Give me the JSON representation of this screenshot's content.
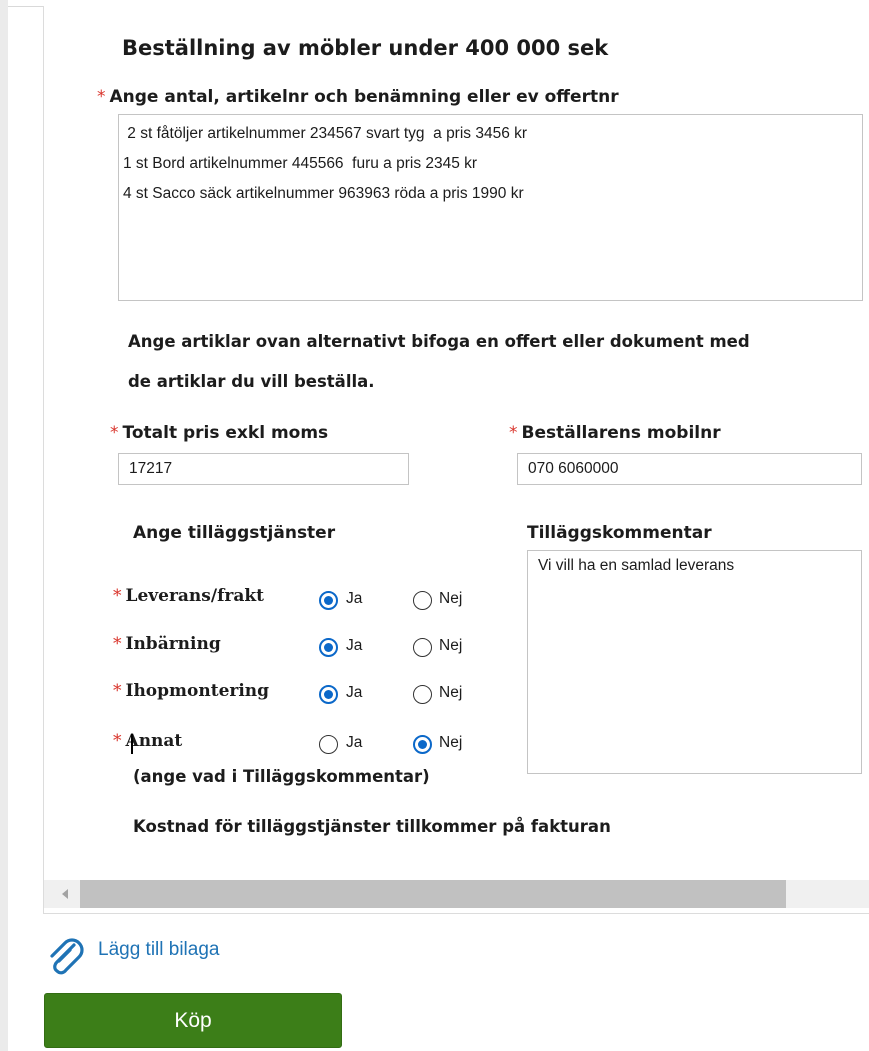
{
  "form": {
    "title": "Beställning av möbler under 400 000 sek",
    "required_marker": "*",
    "articles": {
      "label": "Ange antal, artikelnr och benämning eller ev offertnr",
      "lines": [
        " 2 st fåtöljer artikelnummer 234567 svart tyg  a pris 3456 kr",
        "1 st Bord artikelnummer 445566  furu a pris 2345 kr",
        "4 st Sacco säck artikelnummer 963963 röda a pris 1990 kr"
      ]
    },
    "info_line1": "Ange artiklar ovan alternativt bifoga en offert eller dokument med",
    "info_line2": "de artiklar du vill beställa.",
    "total_price": {
      "label": "Totalt pris exkl moms",
      "value": "17217"
    },
    "mobile": {
      "label": "Beställarens mobilnr",
      "value": "070 6060000"
    },
    "services_heading": "Ange tilläggstjänster",
    "comment": {
      "label": "Tilläggskommentar",
      "value": "Vi vill ha en samlad leverans"
    },
    "yes_label": "Ja",
    "no_label": "Nej",
    "services": [
      {
        "label": "Leverans/frakt",
        "selected": "Ja"
      },
      {
        "label": "Inbärning",
        "selected": "Ja"
      },
      {
        "label": "Ihopmontering",
        "selected": "Ja"
      },
      {
        "label": "Annat",
        "selected": "Nej"
      }
    ],
    "annat_hint": "(ange vad i Tilläggskommentar)",
    "cost_note": "Kostnad för tilläggstjänster tillkommer på fakturan"
  },
  "attachment": {
    "label": "Lägg till bilaga",
    "icon": "paperclip-icon"
  },
  "buy_button": {
    "label": "Köp"
  },
  "colors": {
    "accent_blue": "#0b68c9",
    "link_blue": "#1f73b5",
    "button_green": "#3c7e18",
    "required_red": "#d9342b"
  }
}
